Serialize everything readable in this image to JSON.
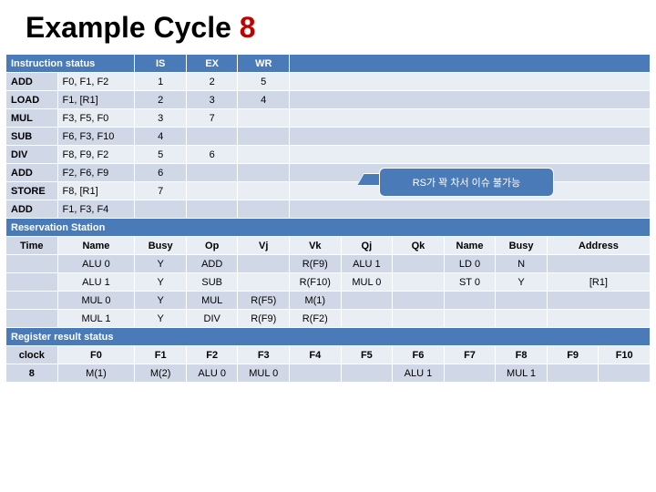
{
  "title_prefix": "Example Cycle ",
  "title_cycle": "8",
  "instr": {
    "header_label": "Instruction status",
    "cols": [
      "IS",
      "EX",
      "WR"
    ],
    "rows": [
      {
        "op": "ADD",
        "args": "F0, F1, F2",
        "is": "1",
        "ex": "2",
        "wr": "5"
      },
      {
        "op": "LOAD",
        "args": "F1, [R1]",
        "is": "2",
        "ex": "3",
        "wr": "4"
      },
      {
        "op": "MUL",
        "args": "F3, F5, F0",
        "is": "3",
        "ex": "7",
        "wr": ""
      },
      {
        "op": "SUB",
        "args": "F6, F3, F10",
        "is": "4",
        "ex": "",
        "wr": ""
      },
      {
        "op": "DIV",
        "args": "F8, F9, F2",
        "is": "5",
        "ex": "6",
        "wr": ""
      },
      {
        "op": "ADD",
        "args": "F2, F6, F9",
        "is": "6",
        "ex": "",
        "wr": ""
      },
      {
        "op": "STORE",
        "args": "F8, [R1]",
        "is": "7",
        "ex": "",
        "wr": ""
      },
      {
        "op": "ADD",
        "args": "F1, F3, F4",
        "is": "",
        "ex": "",
        "wr": ""
      }
    ]
  },
  "callout": "RS가 꽉 차서 이슈 불가능",
  "rs": {
    "header_label": "Reservation Station",
    "cols": [
      "Time",
      "Name",
      "Busy",
      "Op",
      "Vj",
      "Vk",
      "Qj",
      "Qk",
      "Name",
      "Busy",
      "Address"
    ],
    "rows": [
      {
        "time": "",
        "name": "ALU 0",
        "busy": "Y",
        "op": "ADD",
        "vj": "",
        "vk": "R(F9)",
        "qj": "ALU 1",
        "qk": "",
        "n2": "LD 0",
        "b2": "N",
        "addr": ""
      },
      {
        "time": "",
        "name": "ALU 1",
        "busy": "Y",
        "op": "SUB",
        "vj": "",
        "vk": "R(F10)",
        "qj": "MUL 0",
        "qk": "",
        "n2": "ST 0",
        "b2": "Y",
        "addr": "[R1]"
      },
      {
        "time": "",
        "name": "MUL 0",
        "busy": "Y",
        "op": "MUL",
        "vj": "R(F5)",
        "vk": "M(1)",
        "qj": "",
        "qk": "",
        "n2": "",
        "b2": "",
        "addr": ""
      },
      {
        "time": "",
        "name": "MUL 1",
        "busy": "Y",
        "op": "DIV",
        "vj": "R(F9)",
        "vk": "R(F2)",
        "qj": "",
        "qk": "",
        "n2": "",
        "b2": "",
        "addr": ""
      }
    ]
  },
  "reg": {
    "header_label": "Register result status",
    "headers": [
      "clock",
      "F0",
      "F1",
      "F2",
      "F3",
      "F4",
      "F5",
      "F6",
      "F7",
      "F8",
      "F9",
      "F10"
    ],
    "row": [
      "8",
      "M(1)",
      "M(2)",
      "ALU 0",
      "MUL 0",
      "",
      "",
      "ALU 1",
      "",
      "MUL 1",
      "",
      ""
    ]
  }
}
